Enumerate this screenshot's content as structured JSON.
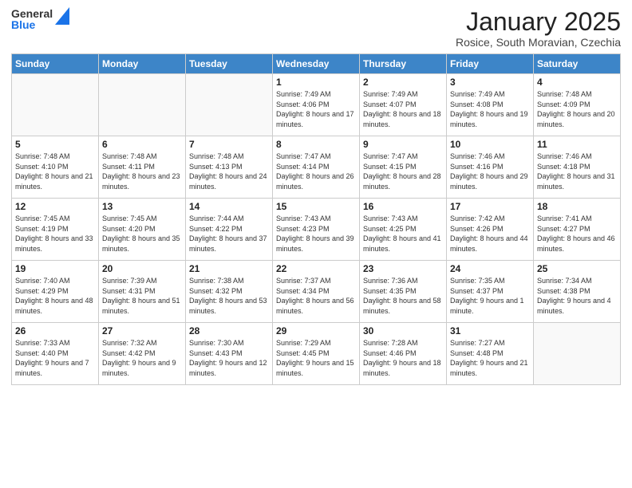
{
  "header": {
    "logo_line1": "General",
    "logo_line2": "Blue",
    "month": "January 2025",
    "location": "Rosice, South Moravian, Czechia"
  },
  "days_of_week": [
    "Sunday",
    "Monday",
    "Tuesday",
    "Wednesday",
    "Thursday",
    "Friday",
    "Saturday"
  ],
  "weeks": [
    [
      {
        "day": "",
        "info": ""
      },
      {
        "day": "",
        "info": ""
      },
      {
        "day": "",
        "info": ""
      },
      {
        "day": "1",
        "info": "Sunrise: 7:49 AM\nSunset: 4:06 PM\nDaylight: 8 hours\nand 17 minutes."
      },
      {
        "day": "2",
        "info": "Sunrise: 7:49 AM\nSunset: 4:07 PM\nDaylight: 8 hours\nand 18 minutes."
      },
      {
        "day": "3",
        "info": "Sunrise: 7:49 AM\nSunset: 4:08 PM\nDaylight: 8 hours\nand 19 minutes."
      },
      {
        "day": "4",
        "info": "Sunrise: 7:48 AM\nSunset: 4:09 PM\nDaylight: 8 hours\nand 20 minutes."
      }
    ],
    [
      {
        "day": "5",
        "info": "Sunrise: 7:48 AM\nSunset: 4:10 PM\nDaylight: 8 hours\nand 21 minutes."
      },
      {
        "day": "6",
        "info": "Sunrise: 7:48 AM\nSunset: 4:11 PM\nDaylight: 8 hours\nand 23 minutes."
      },
      {
        "day": "7",
        "info": "Sunrise: 7:48 AM\nSunset: 4:13 PM\nDaylight: 8 hours\nand 24 minutes."
      },
      {
        "day": "8",
        "info": "Sunrise: 7:47 AM\nSunset: 4:14 PM\nDaylight: 8 hours\nand 26 minutes."
      },
      {
        "day": "9",
        "info": "Sunrise: 7:47 AM\nSunset: 4:15 PM\nDaylight: 8 hours\nand 28 minutes."
      },
      {
        "day": "10",
        "info": "Sunrise: 7:46 AM\nSunset: 4:16 PM\nDaylight: 8 hours\nand 29 minutes."
      },
      {
        "day": "11",
        "info": "Sunrise: 7:46 AM\nSunset: 4:18 PM\nDaylight: 8 hours\nand 31 minutes."
      }
    ],
    [
      {
        "day": "12",
        "info": "Sunrise: 7:45 AM\nSunset: 4:19 PM\nDaylight: 8 hours\nand 33 minutes."
      },
      {
        "day": "13",
        "info": "Sunrise: 7:45 AM\nSunset: 4:20 PM\nDaylight: 8 hours\nand 35 minutes."
      },
      {
        "day": "14",
        "info": "Sunrise: 7:44 AM\nSunset: 4:22 PM\nDaylight: 8 hours\nand 37 minutes."
      },
      {
        "day": "15",
        "info": "Sunrise: 7:43 AM\nSunset: 4:23 PM\nDaylight: 8 hours\nand 39 minutes."
      },
      {
        "day": "16",
        "info": "Sunrise: 7:43 AM\nSunset: 4:25 PM\nDaylight: 8 hours\nand 41 minutes."
      },
      {
        "day": "17",
        "info": "Sunrise: 7:42 AM\nSunset: 4:26 PM\nDaylight: 8 hours\nand 44 minutes."
      },
      {
        "day": "18",
        "info": "Sunrise: 7:41 AM\nSunset: 4:27 PM\nDaylight: 8 hours\nand 46 minutes."
      }
    ],
    [
      {
        "day": "19",
        "info": "Sunrise: 7:40 AM\nSunset: 4:29 PM\nDaylight: 8 hours\nand 48 minutes."
      },
      {
        "day": "20",
        "info": "Sunrise: 7:39 AM\nSunset: 4:31 PM\nDaylight: 8 hours\nand 51 minutes."
      },
      {
        "day": "21",
        "info": "Sunrise: 7:38 AM\nSunset: 4:32 PM\nDaylight: 8 hours\nand 53 minutes."
      },
      {
        "day": "22",
        "info": "Sunrise: 7:37 AM\nSunset: 4:34 PM\nDaylight: 8 hours\nand 56 minutes."
      },
      {
        "day": "23",
        "info": "Sunrise: 7:36 AM\nSunset: 4:35 PM\nDaylight: 8 hours\nand 58 minutes."
      },
      {
        "day": "24",
        "info": "Sunrise: 7:35 AM\nSunset: 4:37 PM\nDaylight: 9 hours\nand 1 minute."
      },
      {
        "day": "25",
        "info": "Sunrise: 7:34 AM\nSunset: 4:38 PM\nDaylight: 9 hours\nand 4 minutes."
      }
    ],
    [
      {
        "day": "26",
        "info": "Sunrise: 7:33 AM\nSunset: 4:40 PM\nDaylight: 9 hours\nand 7 minutes."
      },
      {
        "day": "27",
        "info": "Sunrise: 7:32 AM\nSunset: 4:42 PM\nDaylight: 9 hours\nand 9 minutes."
      },
      {
        "day": "28",
        "info": "Sunrise: 7:30 AM\nSunset: 4:43 PM\nDaylight: 9 hours\nand 12 minutes."
      },
      {
        "day": "29",
        "info": "Sunrise: 7:29 AM\nSunset: 4:45 PM\nDaylight: 9 hours\nand 15 minutes."
      },
      {
        "day": "30",
        "info": "Sunrise: 7:28 AM\nSunset: 4:46 PM\nDaylight: 9 hours\nand 18 minutes."
      },
      {
        "day": "31",
        "info": "Sunrise: 7:27 AM\nSunset: 4:48 PM\nDaylight: 9 hours\nand 21 minutes."
      },
      {
        "day": "",
        "info": ""
      }
    ]
  ]
}
